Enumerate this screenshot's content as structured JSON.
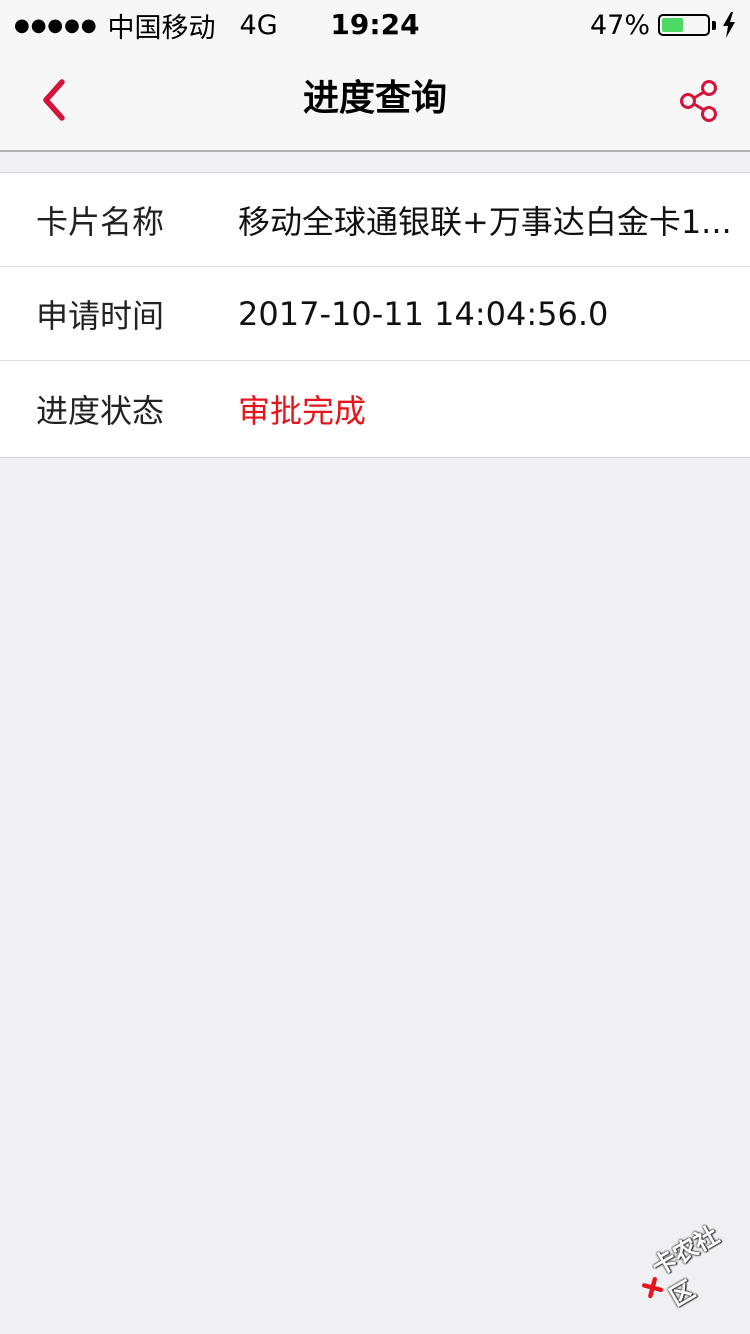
{
  "status_bar": {
    "signal": "●●●●●",
    "carrier": "中国移动",
    "network": "4G",
    "time": "19:24",
    "battery_percent_text": "47%",
    "battery_level": 0.47,
    "battery_color": "#4cd964",
    "charging_icon": "bolt-icon"
  },
  "nav": {
    "back_icon": "chevron-left-icon",
    "title": "进度查询",
    "share_icon": "share-icon",
    "accent_color": "#d4143a"
  },
  "info": {
    "rows": [
      {
        "label": "卡片名称",
        "value": "移动全球通银联+万事达白金卡1..."
      },
      {
        "label": "申请时间",
        "value": "2017-10-11 14:04:56.0"
      },
      {
        "label": "进度状态",
        "value": "审批完成"
      }
    ],
    "status_color": "#e4161b"
  },
  "watermark": {
    "text": "卡农社区"
  }
}
